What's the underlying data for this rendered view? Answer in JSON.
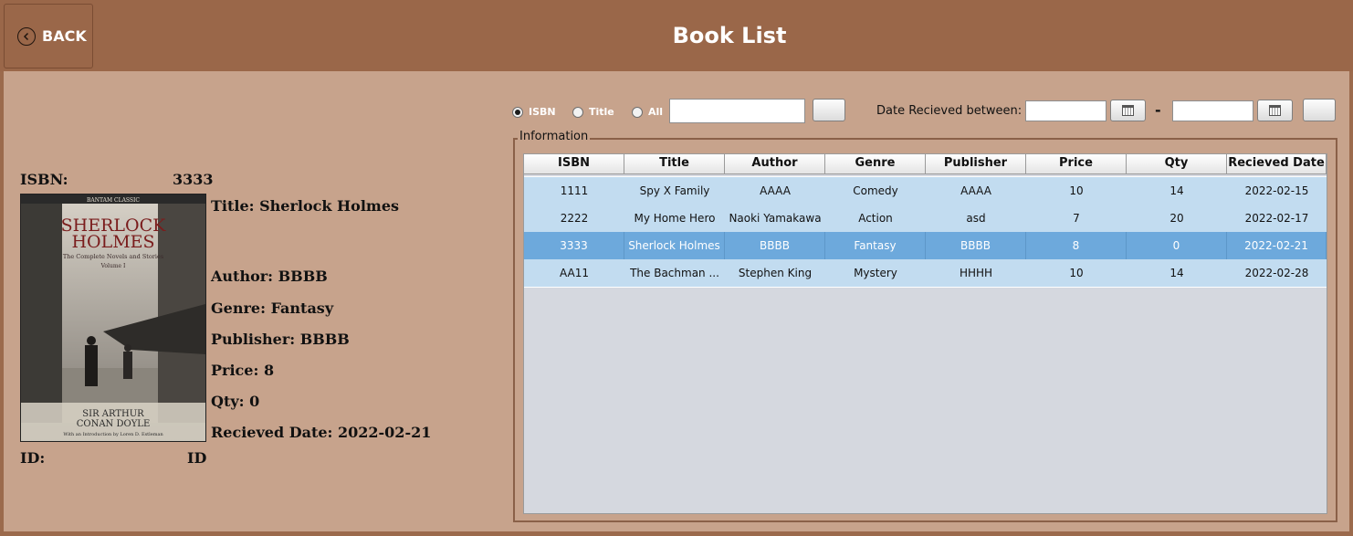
{
  "header": {
    "title": "Book List",
    "back_label": "BACK"
  },
  "detail": {
    "isbn_label": "ISBN:",
    "isbn_value": "3333",
    "title": "Title: Sherlock Holmes",
    "author": "Author: BBBB",
    "genre": "Genre: Fantasy",
    "publisher": "Publisher: BBBB",
    "price": "Price: 8",
    "qty": "Qty: 0",
    "received": "Recieved Date: 2022-02-21",
    "id_label": "ID:",
    "id_value": "ID",
    "cover": {
      "top_band": "BANTAM CLASSIC",
      "line1": "SHERLOCK",
      "line2": "HOLMES",
      "subtitle": "The Complete Novels and Stories",
      "volume": "Volume I",
      "author1": "SIR ARTHUR",
      "author2": "CONAN DOYLE",
      "intro": "With an Introduction by Loren D. Estleman"
    }
  },
  "search": {
    "radios": [
      {
        "label": "ISBN",
        "selected": true
      },
      {
        "label": "Title",
        "selected": false
      },
      {
        "label": "All",
        "selected": false
      }
    ],
    "query": "",
    "date_label": "Date Recieved between:",
    "dash": "-",
    "date_from": "",
    "date_to": ""
  },
  "info_panel": {
    "legend": "Information"
  },
  "table": {
    "columns": [
      "ISBN",
      "Title",
      "Author",
      "Genre",
      "Publisher",
      "Price",
      "Qty",
      "Recieved Date"
    ],
    "rows": [
      [
        "1111",
        "Spy X Family",
        "AAAA",
        "Comedy",
        "AAAA",
        "10",
        "14",
        "2022-02-15"
      ],
      [
        "2222",
        "My Home Hero",
        "Naoki Yamakawa",
        "Action",
        "asd",
        "7",
        "20",
        "2022-02-17"
      ],
      [
        "3333",
        "Sherlock Holmes",
        "BBBB",
        "Fantasy",
        "BBBB",
        "8",
        "0",
        "2022-02-21"
      ],
      [
        "AA11",
        "The Bachman ...",
        "Stephen King",
        "Mystery",
        "HHHH",
        "10",
        "14",
        "2022-02-28"
      ]
    ],
    "selected_row": 2
  },
  "colors": {
    "header_bg": "#9a6749",
    "panel_bg": "#c7a38c",
    "row_bg": "#c2dcf0",
    "row_selected": "#6da9dc"
  }
}
